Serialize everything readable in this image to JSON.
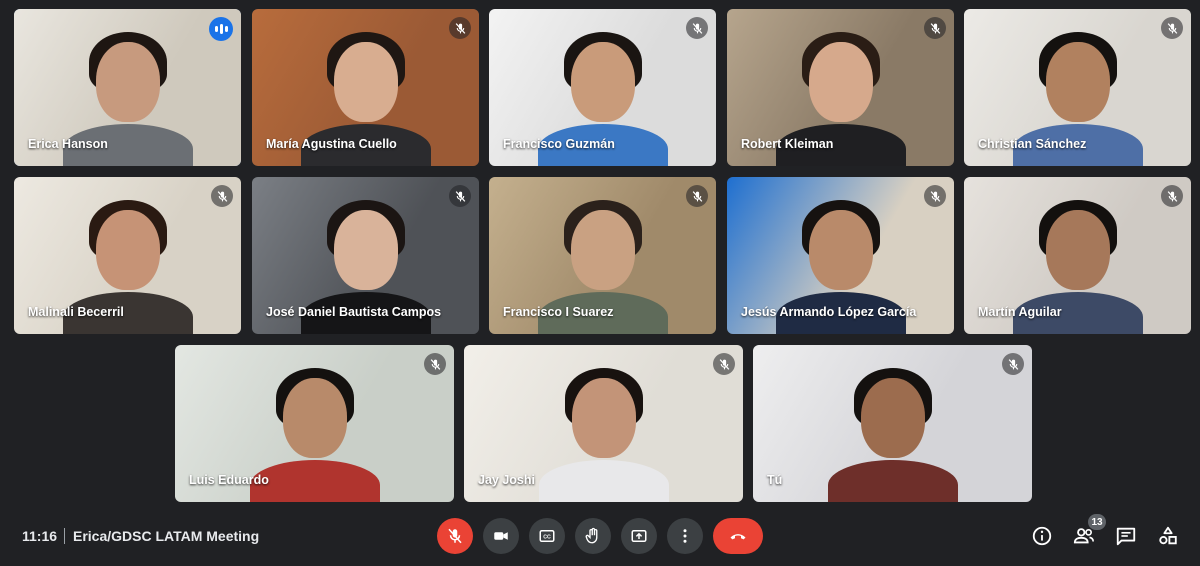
{
  "participants": [
    {
      "name": "Erica Hanson",
      "status": "speaking",
      "bg": "#cfc9bd",
      "wall": "#e9e6df",
      "skin": "#c79a7e",
      "hair": "#1e1612",
      "shirt": "#6b6f74"
    },
    {
      "name": "María Agustina Cuello",
      "status": "muted",
      "bg": "#9b5a35",
      "wall": "#b86c3c",
      "skin": "#d8ad90",
      "hair": "#1f1713",
      "shirt": "#2b2b2e"
    },
    {
      "name": "Francisco Guzmán",
      "status": "muted",
      "bg": "#dcdcdc",
      "wall": "#f3f3f3",
      "skin": "#c99b7a",
      "hair": "#1a1512",
      "shirt": "#3b78c4"
    },
    {
      "name": "Robert Kleiman",
      "status": "muted",
      "bg": "#8a7a66",
      "wall": "#b6a58d",
      "skin": "#d6a98c",
      "hair": "#2a1d15",
      "shirt": "#1f1f22"
    },
    {
      "name": "Christian Sánchez",
      "status": "muted",
      "bg": "#d9d6d0",
      "wall": "#eceae6",
      "skin": "#b1815f",
      "hair": "#14110f",
      "shirt": "#4e6fa6"
    },
    {
      "name": "Malinali Becerril",
      "status": "muted",
      "bg": "#d8d2c6",
      "wall": "#ede9e1",
      "skin": "#c69376",
      "hair": "#2a1a12",
      "shirt": "#3a3532"
    },
    {
      "name": "José Daniel Bautista Campos",
      "status": "muted",
      "bg": "#4f5257",
      "wall": "#7b7f85",
      "skin": "#d9b39a",
      "hair": "#1b1513",
      "shirt": "#151517"
    },
    {
      "name": "Francisco I Suarez",
      "status": "muted",
      "bg": "#a08a6a",
      "wall": "#c4b08e",
      "skin": "#c9a182",
      "hair": "#2b211b",
      "shirt": "#5f6b5a"
    },
    {
      "name": "Jesús Armando López García",
      "status": "muted",
      "bg": "#d8d0c2",
      "wall": "#1e6fd0",
      "skin": "#b98a6a",
      "hair": "#161210",
      "shirt": "#1f2b44"
    },
    {
      "name": "Martín Aguilar",
      "status": "muted",
      "bg": "#cfcac4",
      "wall": "#e6e2dd",
      "skin": "#a6785a",
      "hair": "#13100e",
      "shirt": "#3d4a66"
    },
    {
      "name": "Luis Eduardo",
      "status": "muted",
      "bg": "#c9cfc8",
      "wall": "#e3e7e2",
      "skin": "#b88a6a",
      "hair": "#14110f",
      "shirt": "#b0342e"
    },
    {
      "name": "Jay Joshi",
      "status": "muted",
      "bg": "#e0ddd6",
      "wall": "#f2efe9",
      "skin": "#c39478",
      "hair": "#18120f",
      "shirt": "#e8e8ea"
    },
    {
      "name": "Tú",
      "status": "muted",
      "bg": "#d4d4d8",
      "wall": "#eeeeef",
      "skin": "#9c6c4e",
      "hair": "#14110f",
      "shirt": "#6e2f2a"
    }
  ],
  "bottom_bar": {
    "time": "11:16",
    "meeting_title": "Erica/GDSC LATAM Meeting",
    "participant_count": "13"
  },
  "colors": {
    "background": "#202124",
    "control": "#3c4043",
    "danger": "#ea4335",
    "speaking": "#1a73e8",
    "active_border": "#8ab4f8"
  },
  "icons": {
    "participant_muted": "mic-off-icon",
    "participant_speaking": "audio-level-icon",
    "controls": [
      "mic-off-icon",
      "camera-icon",
      "captions-icon",
      "raise-hand-icon",
      "present-icon",
      "more-options-icon",
      "end-call-icon"
    ],
    "side_panel": [
      "info-icon",
      "people-icon",
      "chat-icon",
      "activities-icon"
    ]
  }
}
